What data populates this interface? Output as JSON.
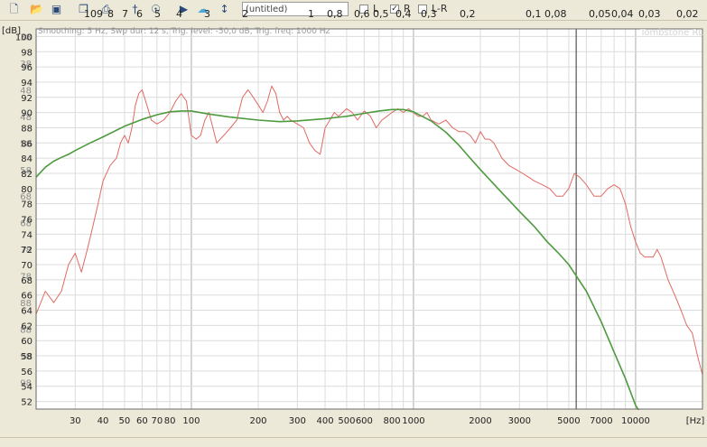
{
  "toolbar": {
    "title_value": "(untitled)",
    "icons": [
      "new-file-icon",
      "open-folder-icon",
      "save-icon",
      "copy-icon",
      "print-icon",
      "marker-icon",
      "target-icon",
      "play-icon",
      "cloud-icon",
      "resize-icon"
    ],
    "checkboxes": [
      {
        "label": "L",
        "checked": false
      },
      {
        "label": "R",
        "checked": true
      },
      {
        "label": "L-R",
        "checked": false
      }
    ],
    "wavelength_scale": [
      "10",
      "9",
      "8",
      "7",
      "6",
      "5",
      "4",
      "3",
      "2",
      "1",
      "0,8",
      "0,6",
      "0,5",
      "0,4",
      "0,3",
      "0,2",
      "0,1",
      "0,08",
      "0,05",
      "0,04",
      "0,03",
      "0,02"
    ]
  },
  "status_text": "Smoothing: 5 Hz, Swp dur: 12 s, Trig. level: -50,0 dB, Trig. freq: 1000 Hz",
  "watermark": "Tombstone RL",
  "chart_data": {
    "type": "line",
    "ylabel": "[dB]",
    "xlabel": "[Hz]",
    "xscale": "log",
    "xlim": [
      20,
      20000
    ],
    "ylim": [
      51,
      101
    ],
    "grid": true,
    "y_ticks": [
      52,
      54,
      56,
      58,
      60,
      62,
      64,
      66,
      68,
      70,
      72,
      74,
      76,
      78,
      80,
      82,
      84,
      86,
      88,
      90,
      92,
      94,
      96,
      98,
      100
    ],
    "y_ticks_ghost": [
      "38",
      "38",
      "48",
      "48",
      "58",
      "58",
      "68",
      "68",
      "78",
      "78",
      "88",
      "88",
      "98",
      "98"
    ],
    "x_ticks": [
      {
        "v": 30,
        "l": "30"
      },
      {
        "v": 40,
        "l": "40"
      },
      {
        "v": 50,
        "l": "50"
      },
      {
        "v": 60,
        "l": "60"
      },
      {
        "v": 70,
        "l": "70"
      },
      {
        "v": 80,
        "l": "80"
      },
      {
        "v": 100,
        "l": "100"
      },
      {
        "v": 200,
        "l": "200"
      },
      {
        "v": 300,
        "l": "300"
      },
      {
        "v": 400,
        "l": "400"
      },
      {
        "v": 500,
        "l": "500"
      },
      {
        "v": 600,
        "l": "600"
      },
      {
        "v": 800,
        "l": "800"
      },
      {
        "v": 1000,
        "l": "1000"
      },
      {
        "v": 2000,
        "l": "2000"
      },
      {
        "v": 3000,
        "l": "3000"
      },
      {
        "v": 5000,
        "l": "5000"
      },
      {
        "v": 7000,
        "l": "7000"
      },
      {
        "v": 10000,
        "l": "10000"
      }
    ],
    "series": [
      {
        "color": "#e06a63",
        "x": [
          20,
          22,
          24,
          26,
          28,
          30,
          32,
          34,
          36,
          38,
          40,
          43,
          46,
          48,
          50,
          52,
          54,
          56,
          58,
          60,
          63,
          66,
          70,
          75,
          80,
          85,
          90,
          95,
          100,
          105,
          110,
          115,
          120,
          125,
          130,
          140,
          150,
          160,
          170,
          180,
          190,
          200,
          210,
          220,
          230,
          240,
          250,
          260,
          270,
          280,
          300,
          320,
          340,
          360,
          380,
          400,
          420,
          440,
          460,
          480,
          500,
          530,
          560,
          600,
          640,
          680,
          720,
          760,
          800,
          850,
          900,
          950,
          1000,
          1050,
          1100,
          1150,
          1200,
          1300,
          1400,
          1500,
          1600,
          1700,
          1800,
          1900,
          2000,
          2100,
          2200,
          2300,
          2400,
          2500,
          2700,
          2900,
          3100,
          3300,
          3500,
          3800,
          4100,
          4400,
          4700,
          5000,
          5300,
          5600,
          6000,
          6500,
          7000,
          7500,
          8000,
          8500,
          9000,
          9500,
          10000,
          10500,
          11000,
          11500,
          12000,
          12500,
          13000,
          14000,
          15000,
          16000,
          17000,
          18000,
          19000,
          20000
        ],
        "y": [
          63.5,
          66.5,
          65,
          66.5,
          70,
          71.5,
          69,
          72,
          75,
          78,
          81,
          83,
          84,
          86,
          87,
          86,
          88,
          91,
          92.5,
          93,
          91,
          89,
          88.5,
          89,
          90,
          91.5,
          92.5,
          91.5,
          87,
          86.5,
          87,
          89,
          90,
          88,
          86,
          87,
          88,
          89,
          92,
          93,
          92,
          91,
          90,
          91.5,
          93.5,
          92.5,
          90,
          89,
          89.5,
          89,
          88.5,
          88,
          86,
          85,
          84.5,
          88,
          89,
          90,
          89.5,
          90,
          90.5,
          90,
          89,
          90.2,
          89.5,
          88,
          89,
          89.5,
          90,
          90.5,
          90,
          90.5,
          90,
          89.5,
          89.5,
          90,
          89,
          88.5,
          89,
          88,
          87.5,
          87.5,
          87,
          86,
          87.5,
          86.5,
          86.5,
          86,
          85,
          84,
          83,
          82.5,
          82,
          81.5,
          81,
          80.5,
          80,
          79,
          79,
          80,
          82,
          81.5,
          80.5,
          79,
          79,
          80,
          80.5,
          80,
          78,
          75,
          73,
          71.5,
          71,
          71,
          71,
          72,
          71,
          68,
          66,
          64,
          62,
          61,
          58,
          55.5
        ]
      },
      {
        "color": "#4e9a3e",
        "x": [
          20,
          22,
          24,
          26,
          28,
          30,
          35,
          40,
          50,
          60,
          70,
          80,
          90,
          100,
          120,
          150,
          200,
          250,
          300,
          400,
          500,
          600,
          700,
          800,
          900,
          1000,
          1200,
          1400,
          1600,
          1800,
          2000,
          2400,
          3000,
          3500,
          4000,
          4500,
          5000,
          6000,
          7000,
          8000,
          9000,
          10000,
          10500
        ],
        "y": [
          81.5,
          82.8,
          83.6,
          84.1,
          84.5,
          85,
          86,
          86.8,
          88.2,
          89.1,
          89.7,
          90.1,
          90.2,
          90.2,
          89.8,
          89.4,
          89,
          88.8,
          88.9,
          89.2,
          89.5,
          89.9,
          90.2,
          90.4,
          90.4,
          90.1,
          88.9,
          87.4,
          85.7,
          84,
          82.5,
          80,
          77,
          75,
          73,
          71.5,
          70,
          66.5,
          62.5,
          58.5,
          55,
          51.5,
          50.5
        ]
      }
    ]
  }
}
